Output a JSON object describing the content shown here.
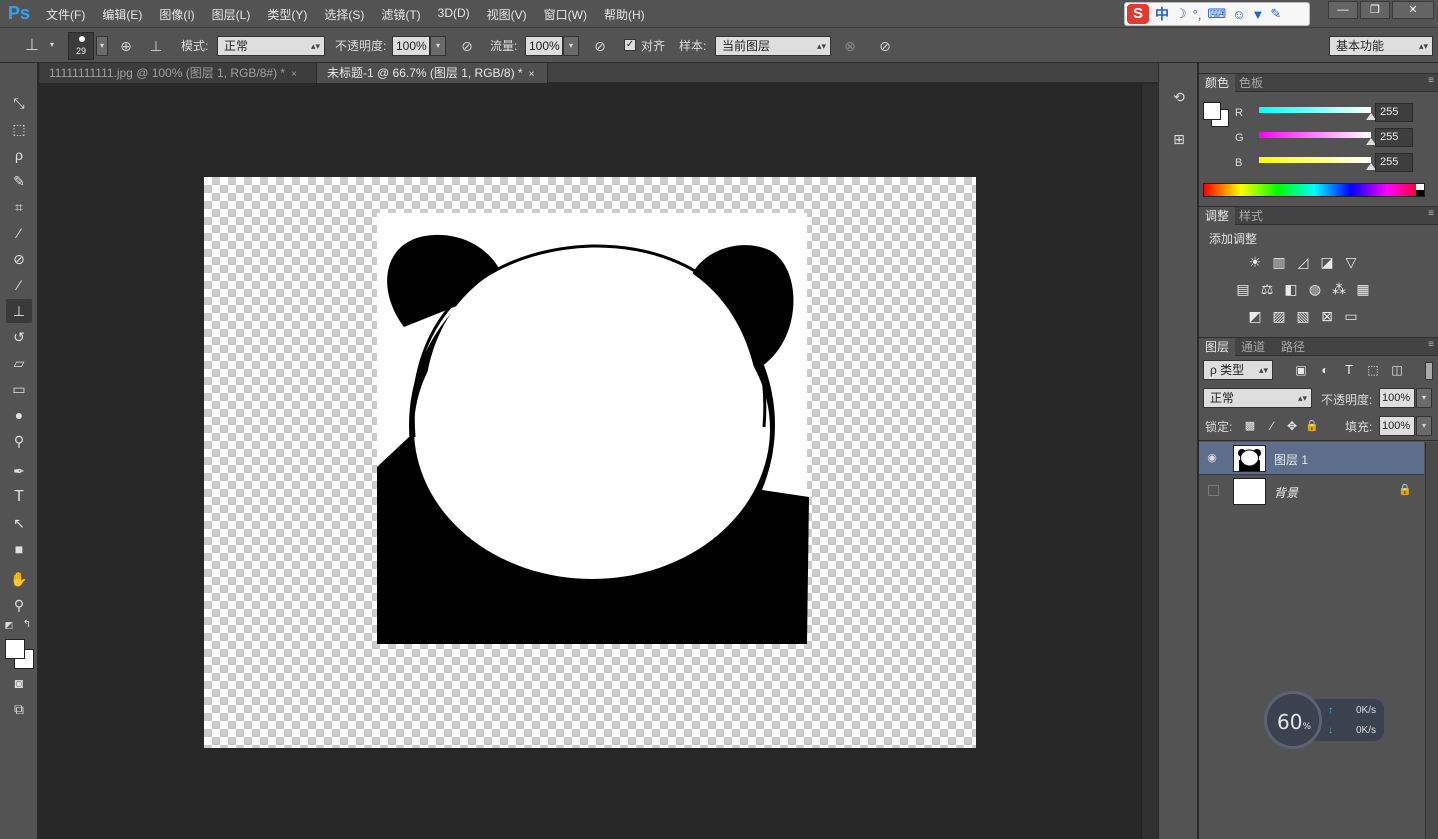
{
  "app": {
    "logo": "Ps"
  },
  "menu": [
    "文件(F)",
    "编辑(E)",
    "图像(I)",
    "图层(L)",
    "类型(Y)",
    "选择(S)",
    "滤镜(T)",
    "3D(D)",
    "视图(V)",
    "窗口(W)",
    "帮助(H)"
  ],
  "ime": {
    "badge": "S",
    "mode": "中"
  },
  "options": {
    "brush_size": "29",
    "mode_label": "模式:",
    "mode_value": "正常",
    "opacity_label": "不透明度:",
    "opacity_value": "100%",
    "flow_label": "流量:",
    "flow_value": "100%",
    "aligned_label": "对齐",
    "sample_label": "样本:",
    "sample_value": "当前图层",
    "workspace": "基本功能"
  },
  "tabs": [
    {
      "label": "11111111111.jpg @ 100% (图层 1, RGB/8#) *"
    },
    {
      "label": "未标题-1 @ 66.7% (图层 1, RGB/8) *"
    }
  ],
  "color_panel": {
    "tabs": [
      "颜色",
      "色板"
    ],
    "channels": [
      {
        "name": "R",
        "value": "255",
        "color": "#00ffff"
      },
      {
        "name": "G",
        "value": "255",
        "color": "#ff00ff"
      },
      {
        "name": "B",
        "value": "255",
        "color": "#ffff00"
      }
    ]
  },
  "adjust_panel": {
    "tabs": [
      "调整",
      "样式"
    ],
    "title": "添加调整"
  },
  "layers_panel": {
    "tabs": [
      "图层",
      "通道",
      "路径"
    ],
    "filter_label": "ρ 类型",
    "blend_mode": "正常",
    "opacity_label": "不透明度:",
    "opacity_value": "100%",
    "lock_label": "锁定:",
    "fill_label": "填充:",
    "fill_value": "100%",
    "layers": [
      {
        "name": "图层 1",
        "selected": true,
        "visible": true
      },
      {
        "name": "背景",
        "selected": false,
        "visible": false,
        "locked": true
      }
    ]
  },
  "net_widget": {
    "percent": "60",
    "percent_sign": "%",
    "up": "0K/s",
    "down": "0K/s"
  }
}
